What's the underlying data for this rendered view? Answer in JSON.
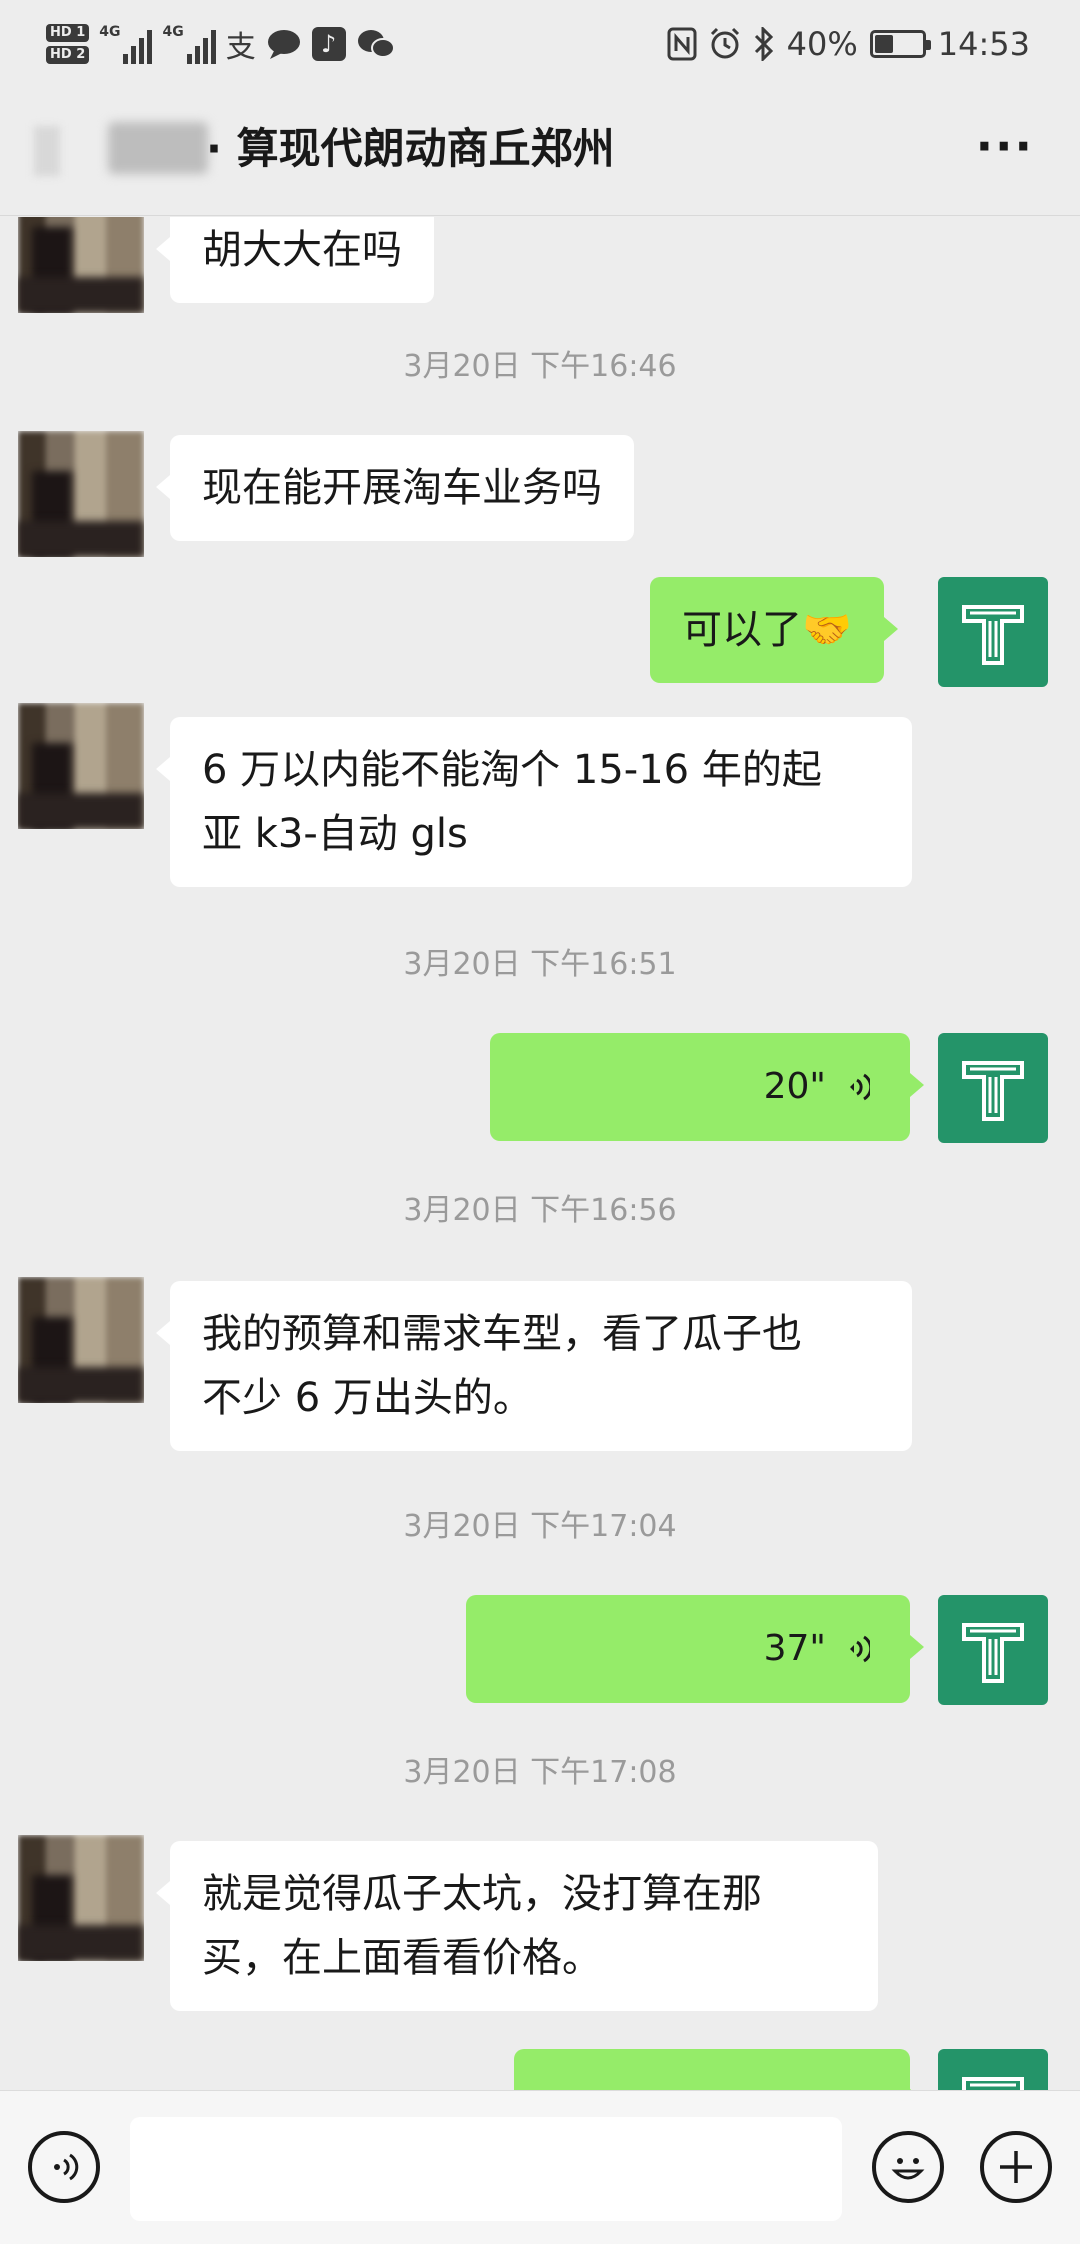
{
  "status_bar": {
    "sim1": "HD 1",
    "sim2": "HD 2",
    "net1": "4G",
    "net2": "4G",
    "alipay_glyph": "支",
    "battery": "40%",
    "battery_level": 0.4,
    "time": "14:53",
    "icons": [
      "nfc-icon",
      "alarm-icon",
      "bluetooth-icon",
      "battery-icon",
      "tiktok-icon",
      "wechat-icon",
      "message-icon",
      "alipay-icon"
    ]
  },
  "header": {
    "title": "· 算现代朗动商丘郑州",
    "more_label": "···"
  },
  "messages": [
    {
      "type": "in",
      "text": "胡大大在吗"
    },
    {
      "type": "time",
      "text": "3月20日 下午16:46"
    },
    {
      "type": "in",
      "text": "现在能开展淘车业务吗"
    },
    {
      "type": "out",
      "text": "可以了🤝"
    },
    {
      "type": "in",
      "line1": "6 万以内能不能淘个 15-16 年的起",
      "line2": "亚 k3-自动 gls"
    },
    {
      "type": "time",
      "text": "3月20日 下午16:51"
    },
    {
      "type": "voice",
      "duration": "20\""
    },
    {
      "type": "time",
      "text": "3月20日 下午16:56"
    },
    {
      "type": "in",
      "line1": "我的预算和需求车型，看了瓜子也",
      "line2": "不少 6 万出头的。"
    },
    {
      "type": "time",
      "text": "3月20日 下午17:04"
    },
    {
      "type": "voice",
      "duration": "37\""
    },
    {
      "type": "time",
      "text": "3月20日 下午17:08"
    },
    {
      "type": "in",
      "line1": "就是觉得瓜子太坑，没打算在那",
      "line2": "买，在上面看看价格。"
    }
  ],
  "colors": {
    "background": "#ededed",
    "incoming_bubble": "#ffffff",
    "outgoing_bubble": "#95ec69",
    "avatar_green": "#249469",
    "timestamp": "#9a9a9a"
  },
  "bottom_bar": {
    "voice_toggle_icon": "voice-icon",
    "emoji_icon": "emoji-icon",
    "plus_icon": "plus-icon"
  }
}
